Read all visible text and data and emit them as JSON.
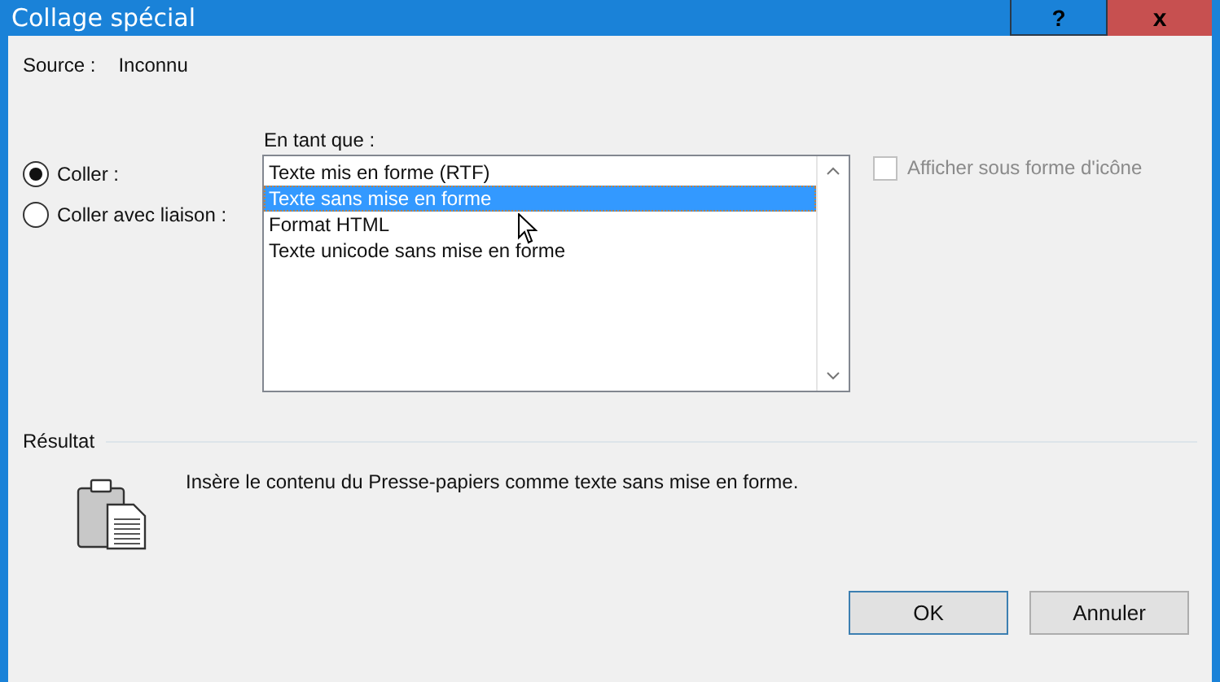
{
  "window": {
    "title": "Collage spécial",
    "controls": [
      {
        "kind": "help",
        "label": "?"
      },
      {
        "kind": "close",
        "label": "x"
      }
    ]
  },
  "source": {
    "label": "Source :",
    "value": "Inconnu"
  },
  "paste_options": [
    {
      "label": "Coller :",
      "selected": true
    },
    {
      "label": "Coller avec liaison :",
      "selected": false
    }
  ],
  "as_list": {
    "label": "En tant que :",
    "items": [
      {
        "label": "Texte mis en forme (RTF)",
        "selected": false
      },
      {
        "label": "Texte sans mise en forme",
        "selected": true
      },
      {
        "label": "Format HTML",
        "selected": false
      },
      {
        "label": "Texte unicode sans mise en forme",
        "selected": false
      }
    ]
  },
  "display_as_icon": {
    "label": "Afficher sous forme d'icône",
    "checked": false,
    "disabled": true
  },
  "result": {
    "heading": "Résultat",
    "description": "Insère le contenu du Presse-papiers comme texte sans mise en forme."
  },
  "buttons": [
    {
      "label": "OK",
      "default": true
    },
    {
      "label": "Annuler",
      "default": false
    }
  ]
}
